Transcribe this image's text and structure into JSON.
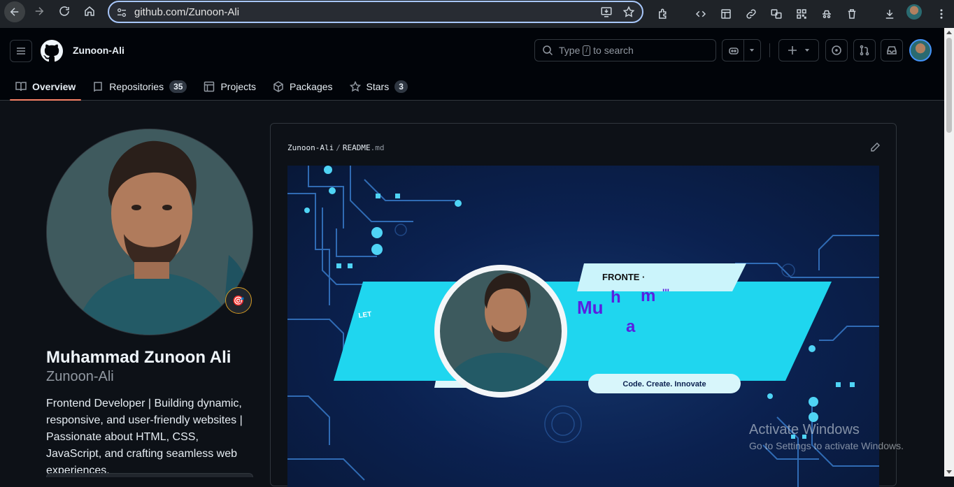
{
  "browser": {
    "url": "github.com/Zunoon-Ali"
  },
  "header": {
    "username": "Zunoon-Ali",
    "search_text_before": "Type",
    "search_key": "/",
    "search_text_after": "to search"
  },
  "tabs": [
    {
      "label": "Overview"
    },
    {
      "label": "Repositories",
      "count": "35"
    },
    {
      "label": "Projects"
    },
    {
      "label": "Packages"
    },
    {
      "label": "Stars",
      "count": "3"
    }
  ],
  "profile": {
    "full_name": "Muhammad Zunoon Ali",
    "login": "Zunoon-Ali",
    "status_emoji": "🎯",
    "bio": "Frontend Developer | Building dynamic, responsive, and user-friendly websites | Passionate about HTML, CSS, JavaScript, and crafting seamless web experiences."
  },
  "readme": {
    "owner": "Zunoon-Ali",
    "separator": "/",
    "file_base": "README",
    "file_ext": ".md",
    "banner": {
      "left_text": "LET",
      "top_label": "FRONTE ·",
      "name_letters": [
        "Mu",
        "h",
        "m",
        "'''",
        "a"
      ],
      "tagline": "Code. Create. Innovate"
    }
  },
  "watermark": {
    "line1": "Activate Windows",
    "line2": "Go to Settings to activate Windows."
  },
  "colors": {
    "accent": "#f78166",
    "banner_cyan": "#1fd6ef",
    "banner_purple": "#5a1fe0"
  }
}
